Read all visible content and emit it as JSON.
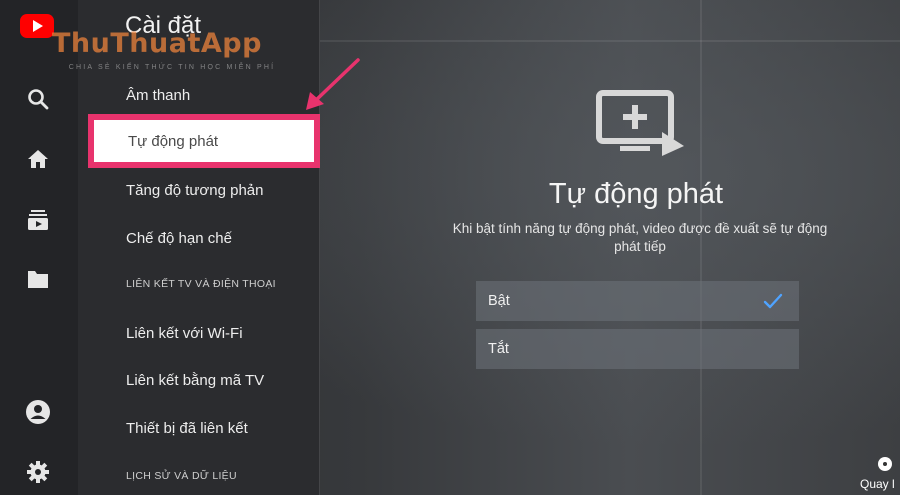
{
  "menu": {
    "title": "Cài đặt",
    "items": [
      {
        "label": "Âm thanh"
      },
      {
        "label": "Tự động phát"
      },
      {
        "label": "Tăng độ tương phản"
      },
      {
        "label": "Chế độ hạn chế"
      },
      {
        "label": "Liên kết với Wi-Fi"
      },
      {
        "label": "Liên kết bằng mã TV"
      },
      {
        "label": "Thiết bị đã liên kết"
      }
    ],
    "sections": [
      {
        "label": "LIÊN KẾT TV VÀ ĐIỆN THOẠI"
      },
      {
        "label": "LỊCH SỬ VÀ DỮ LIỆU"
      }
    ]
  },
  "rail": {
    "icons": [
      "youtube-logo",
      "search-icon",
      "home-icon",
      "subscriptions-icon",
      "library-icon",
      "account-icon",
      "settings-icon"
    ]
  },
  "watermark": {
    "title": "ThuThuatApp",
    "subtitle": "CHIA SẺ KIẾN THỨC TIN HỌC MIỄN PHÍ"
  },
  "detail": {
    "title": "Tự động phát",
    "description": "Khi bật tính năng tự động phát, video được đề xuất sẽ tự động phát tiếp",
    "options": [
      {
        "label": "Bật",
        "selected": true
      },
      {
        "label": "Tắt",
        "selected": false
      }
    ]
  },
  "footer": {
    "back_label": "Quay l"
  },
  "colors": {
    "highlight": "#e8336d",
    "check": "#4fa3ff",
    "youtube_red": "#ff0000"
  }
}
